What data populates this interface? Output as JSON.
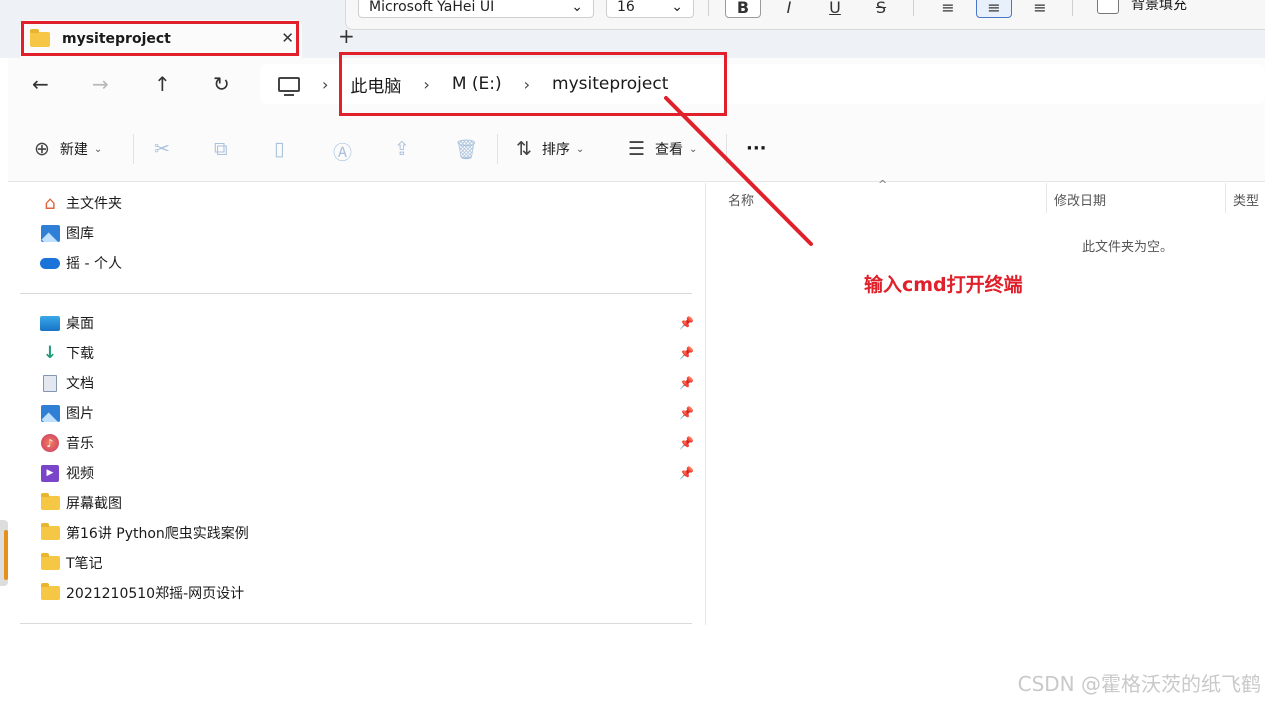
{
  "format_toolbar": {
    "font_name": "Microsoft YaHei UI",
    "font_size": "16",
    "bold_icon": "B",
    "italic_icon": "I",
    "underline_icon": "U",
    "strike_icon": "S",
    "bg_fill_label": "背景填充"
  },
  "tab": {
    "title": "mysiteproject",
    "close": "✕",
    "add": "+"
  },
  "nav": {
    "back": "←",
    "forward": "→",
    "up": "↑",
    "refresh": "↻"
  },
  "breadcrumb": {
    "sep": "›",
    "items": [
      "此电脑",
      "M (E:)",
      "mysiteproject"
    ]
  },
  "commands": {
    "new": "新建",
    "sort": "排序",
    "view": "查看",
    "more": "···"
  },
  "sidebar": {
    "top": [
      {
        "icon": "home-icon",
        "label": "主文件夹"
      },
      {
        "icon": "gallery-icon",
        "label": "图库"
      },
      {
        "icon": "onedrive-icon",
        "label": "摇 - 个人"
      }
    ],
    "pinned": [
      {
        "icon": "desktop-icon",
        "label": "桌面"
      },
      {
        "icon": "download-icon",
        "label": "下载"
      },
      {
        "icon": "document-icon",
        "label": "文档"
      },
      {
        "icon": "pictures-icon",
        "label": "图片"
      },
      {
        "icon": "music-icon",
        "label": "音乐"
      },
      {
        "icon": "video-icon",
        "label": "视频"
      }
    ],
    "folders": [
      {
        "icon": "folder-icon",
        "label": "屏幕截图"
      },
      {
        "icon": "folder-icon",
        "label": "第16讲 Python爬虫实践案例"
      },
      {
        "icon": "folder-icon",
        "label": "T笔记"
      },
      {
        "icon": "folder-icon",
        "label": "2021210510郑摇-网页设计"
      }
    ]
  },
  "columns": {
    "name": "名称",
    "modified": "修改日期",
    "type": "类型"
  },
  "content": {
    "empty_message": "此文件夹为空。"
  },
  "annotation": {
    "text": "输入cmd打开终端",
    "color": "#e0202a"
  },
  "watermark": "CSDN @霍格沃茨的纸飞鹤"
}
